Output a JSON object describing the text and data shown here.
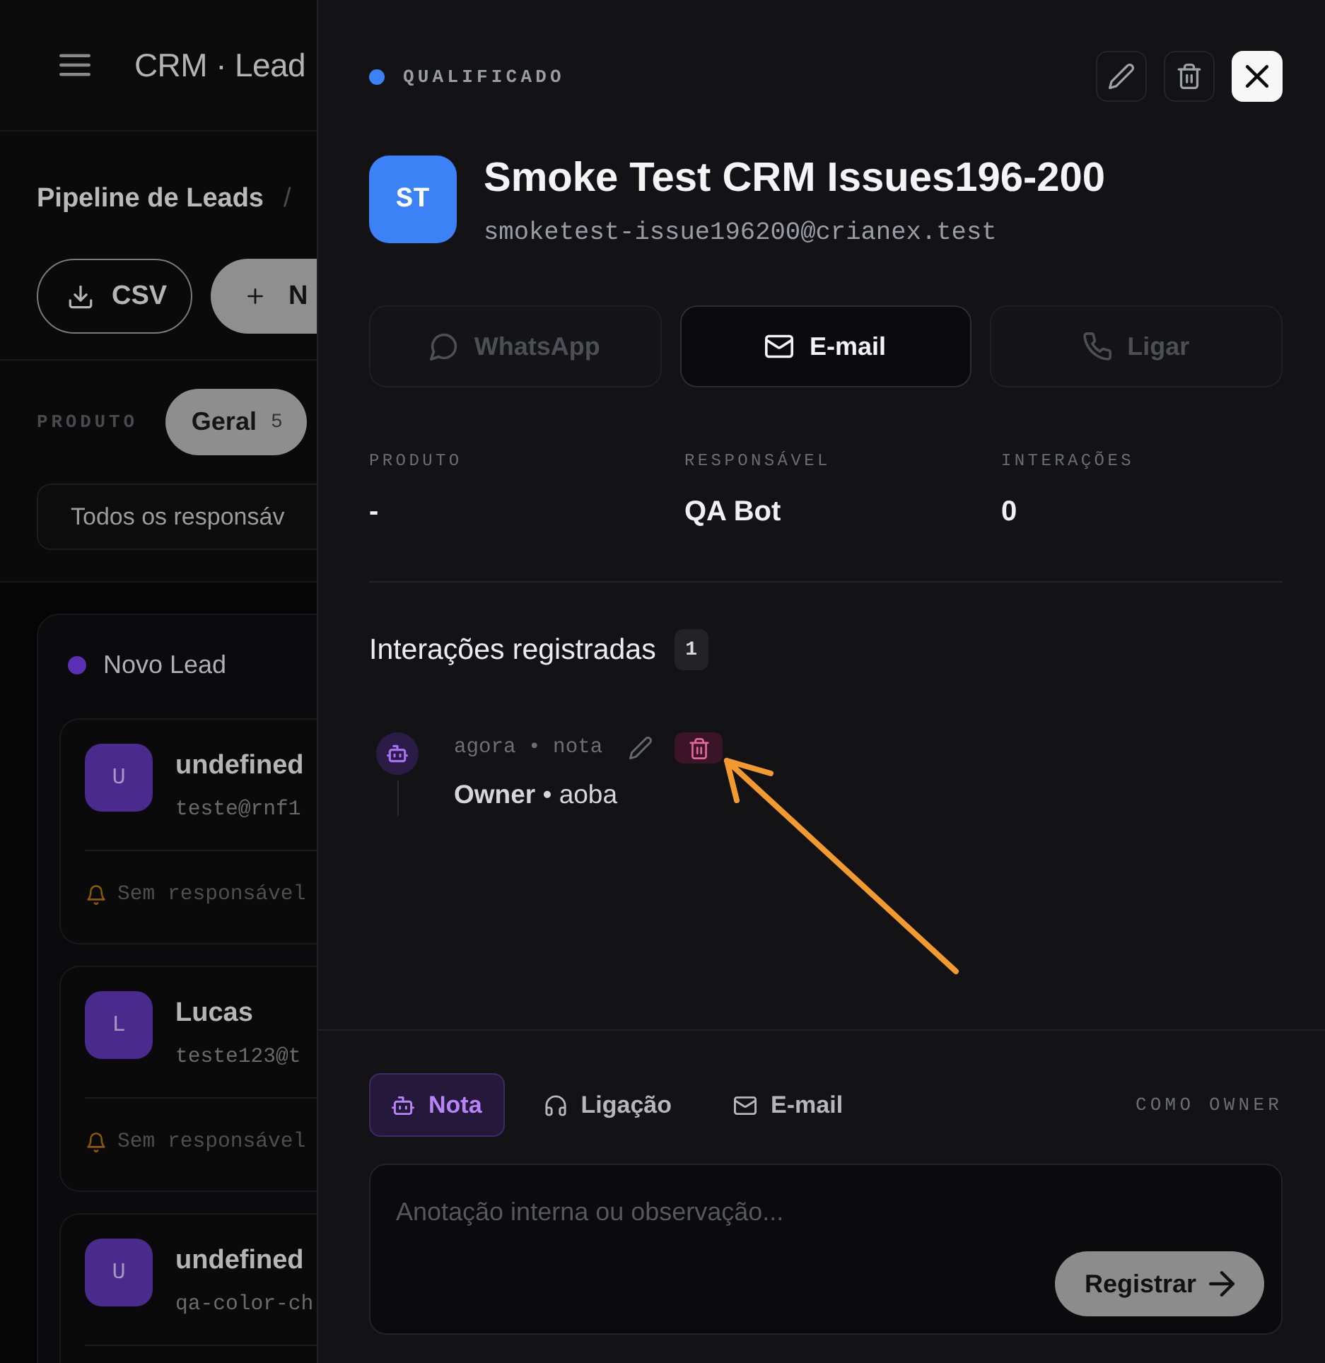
{
  "background_page": {
    "header": {
      "title": "CRM · Lead"
    },
    "breadcrumb": {
      "title": "Pipeline de Leads",
      "separator": "/"
    },
    "actions": [
      {
        "kind": "outline",
        "label": "CSV"
      },
      {
        "kind": "filled",
        "label": "N"
      }
    ],
    "filter": {
      "label": "PRODUTO",
      "chips": [
        {
          "label": "Geral",
          "count": "5",
          "selected": true
        }
      ]
    },
    "owner_select": {
      "value": "Todos os responsáv"
    },
    "column": {
      "title": "Novo Lead",
      "color": "#5a2fb3",
      "cards": [
        {
          "initial": "U",
          "name": "undefined",
          "email": "teste@rnf1",
          "owner": "Sem responsável"
        },
        {
          "initial": "L",
          "name": "Lucas",
          "email": "teste123@t",
          "owner": "Sem responsável"
        },
        {
          "initial": "U",
          "name": "undefined",
          "email": "qa-color-ch"
        }
      ]
    }
  },
  "drawer": {
    "status": {
      "label": "QUALIFICADO",
      "color": "#3b82f6"
    },
    "lead": {
      "initials": "ST",
      "name": "Smoke Test CRM Issues196-200",
      "email": "smoketest-issue196200@crianex.test"
    },
    "contact_actions": [
      {
        "kind": "whatsapp",
        "label": "WhatsApp",
        "disabled": true
      },
      {
        "kind": "email",
        "label": "E-mail",
        "disabled": false
      },
      {
        "kind": "phone",
        "label": "Ligar",
        "disabled": true
      }
    ],
    "stats": [
      {
        "label": "PRODUTO",
        "value": "-"
      },
      {
        "label": "RESPONSÁVEL",
        "value": "QA Bot"
      },
      {
        "label": "INTERAÇÕES",
        "value": "0"
      }
    ],
    "interactions": {
      "title": "Interações registradas",
      "count": "1",
      "items": [
        {
          "kind": "note",
          "meta": "agora • nota",
          "text": "**Owner** • aoba"
        }
      ]
    },
    "composer": {
      "tabs": [
        {
          "kind": "note",
          "label": "Nota",
          "selected": true
        },
        {
          "kind": "call",
          "label": "Ligação",
          "selected": false
        },
        {
          "kind": "email",
          "label": "E-mail",
          "selected": false
        }
      ],
      "author": "COMO OWNER",
      "placeholder": "Anotação interna ou observação...",
      "submit": "Registrar"
    }
  }
}
